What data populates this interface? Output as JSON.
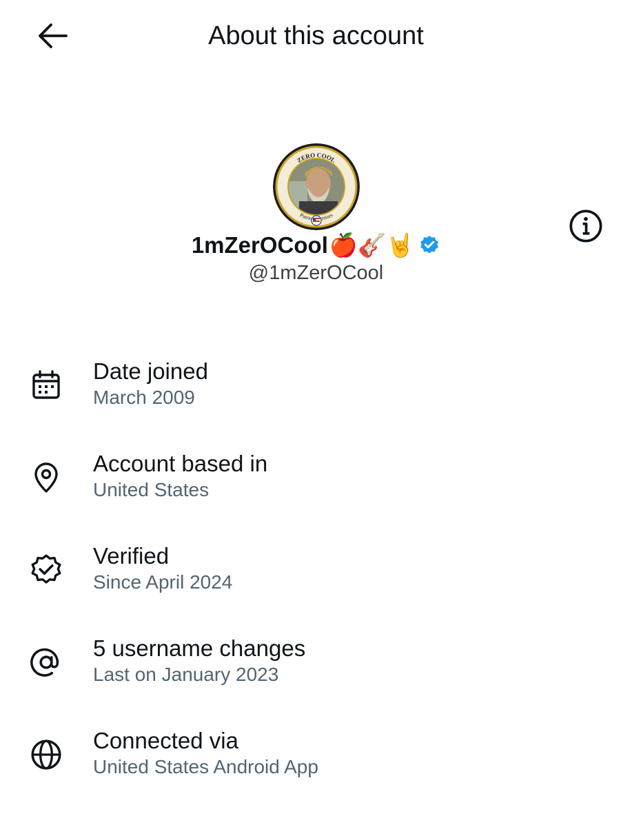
{
  "header": {
    "title": "About this account",
    "back_icon": "arrow-left-icon"
  },
  "profile": {
    "display_name": "1mZerOCool",
    "name_emojis": "🍎🎸🤘",
    "handle": "@1mZerOCool",
    "verified_badge_color": "#1d9bf0",
    "avatar_badge_text_top": "ZERO COOL",
    "avatar_badge_text_ring": "Patriot Warriors"
  },
  "items": [
    {
      "icon": "calendar-icon",
      "title": "Date joined",
      "subtitle": "March 2009"
    },
    {
      "icon": "location-pin-icon",
      "title": "Account based in",
      "subtitle": "United States"
    },
    {
      "icon": "verified-badge-icon",
      "title": "Verified",
      "subtitle": "Since April 2024",
      "action_icon": "info-icon"
    },
    {
      "icon": "at-sign-icon",
      "title": "5 username changes",
      "subtitle": "Last on January 2023"
    },
    {
      "icon": "globe-icon",
      "title": "Connected via",
      "subtitle": "United States Android App"
    }
  ],
  "colors": {
    "text_primary": "#0f1419",
    "text_secondary": "#536471",
    "accent": "#1d9bf0"
  }
}
